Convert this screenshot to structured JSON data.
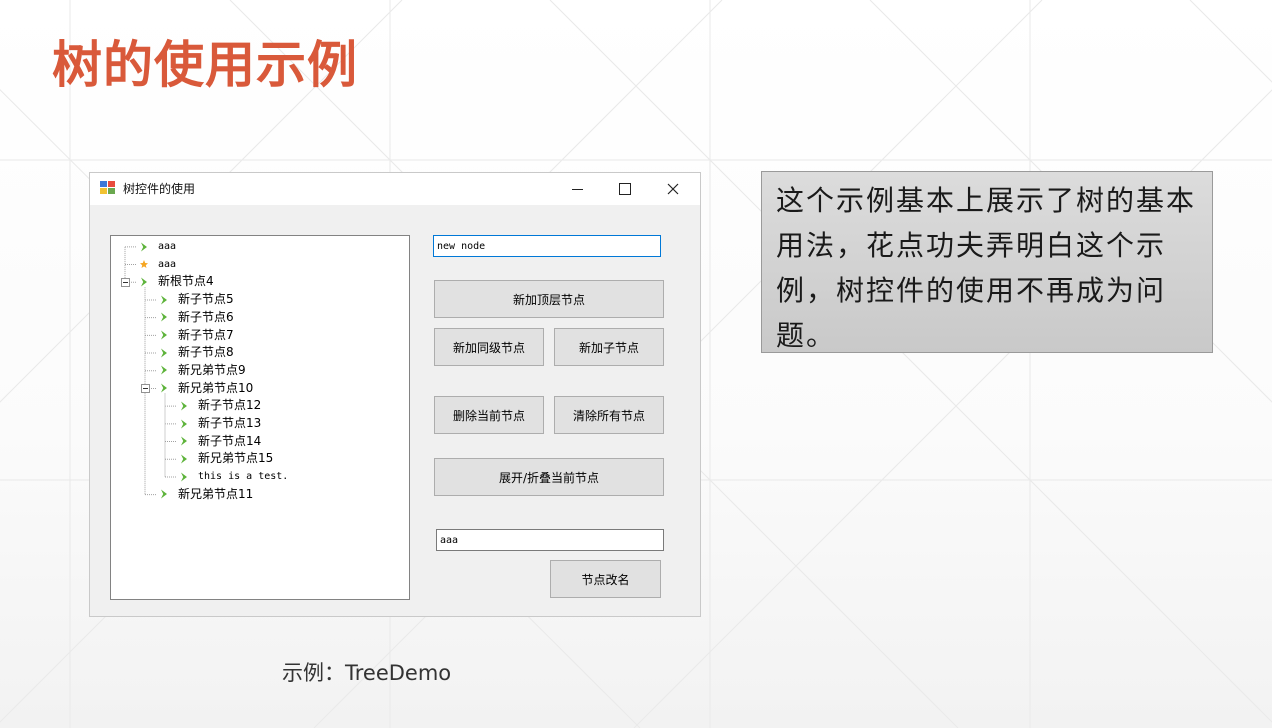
{
  "slide": {
    "title": "树的使用示例",
    "caption": "示例：TreeDemo",
    "description": "这个示例基本上展示了树的基本用法，花点功夫弄明白这个示例，树控件的使用不再成为问题。"
  },
  "window": {
    "title": "树控件的使用",
    "controls": [
      "minimize",
      "maximize",
      "close"
    ]
  },
  "tree": {
    "nodes": [
      {
        "label": "aaa",
        "depth": 0,
        "icon": "chevron-icon",
        "mono": true
      },
      {
        "label": "aaa",
        "depth": 0,
        "icon": "star-icon",
        "mono": true
      },
      {
        "label": "新根节点4",
        "depth": 0,
        "icon": "chevron-icon",
        "expanded": true
      },
      {
        "label": "新子节点5",
        "depth": 1,
        "icon": "chevron-icon"
      },
      {
        "label": "新子节点6",
        "depth": 1,
        "icon": "chevron-icon"
      },
      {
        "label": "新子节点7",
        "depth": 1,
        "icon": "chevron-icon"
      },
      {
        "label": "新子节点8",
        "depth": 1,
        "icon": "chevron-icon"
      },
      {
        "label": "新兄弟节点9",
        "depth": 1,
        "icon": "chevron-icon"
      },
      {
        "label": "新兄弟节点10",
        "depth": 1,
        "icon": "chevron-icon",
        "expanded": true
      },
      {
        "label": "新子节点12",
        "depth": 2,
        "icon": "chevron-icon"
      },
      {
        "label": "新子节点13",
        "depth": 2,
        "icon": "chevron-icon"
      },
      {
        "label": "新子节点14",
        "depth": 2,
        "icon": "chevron-icon"
      },
      {
        "label": "新兄弟节点15",
        "depth": 2,
        "icon": "chevron-icon"
      },
      {
        "label": "this is a test.",
        "depth": 2,
        "icon": "chevron-icon",
        "mono": true
      },
      {
        "label": "新兄弟节点11",
        "depth": 1,
        "icon": "chevron-icon"
      }
    ]
  },
  "form": {
    "node_name_value": "new node",
    "btn_add_top": "新加顶层节点",
    "btn_add_sibling": "新加同级节点",
    "btn_add_child": "新加子节点",
    "btn_delete": "删除当前节点",
    "btn_clear": "清除所有节点",
    "btn_toggle": "展开/折叠当前节点",
    "rename_value": "aaa",
    "btn_rename": "节点改名"
  },
  "colors": {
    "title": "#d9593a",
    "chevron": "#5db33a",
    "star": "#f5a623"
  }
}
